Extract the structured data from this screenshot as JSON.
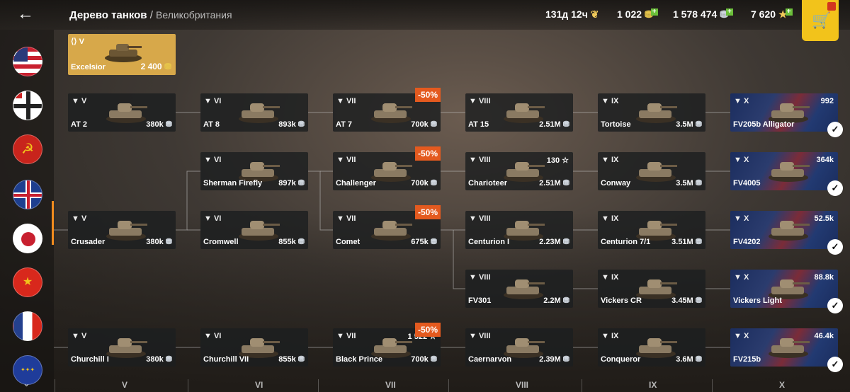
{
  "header": {
    "back_icon": "←",
    "title": "Дерево танков",
    "sep": "/",
    "subtitle": "Великобритания",
    "time": "131д 12ч",
    "gold_bonds": "1 022",
    "silver": "1 578 474",
    "free_xp": "7 620"
  },
  "premium": {
    "tier": "V",
    "name": "Excelsior",
    "price": "2 400"
  },
  "nations": [
    "usa",
    "germany",
    "ussr",
    "uk",
    "japan",
    "china",
    "france",
    "europe"
  ],
  "tiers": [
    "V",
    "VI",
    "VII",
    "VIII",
    "IX",
    "X"
  ],
  "tanks": [
    {
      "tier": "V",
      "name": "AT 2",
      "price": "380k"
    },
    {
      "tier": "VI",
      "name": "AT 8",
      "price": "893k"
    },
    {
      "tier": "VII",
      "name": "AT 7",
      "price": "700k",
      "discount": "-50%"
    },
    {
      "tier": "VIII",
      "name": "AT 15",
      "price": "2.51M"
    },
    {
      "tier": "IX",
      "name": "Tortoise",
      "price": "3.5M"
    },
    {
      "tier": "X",
      "name": "FV205b Alligator",
      "extra": "992"
    },
    {
      "tier": "VI",
      "name": "Sherman Firefly",
      "price": "897k"
    },
    {
      "tier": "VII",
      "name": "Challenger",
      "price": "700k",
      "discount": "-50%"
    },
    {
      "tier": "VIII",
      "name": "Charioteer",
      "price": "2.51M",
      "extra": "130 ☆"
    },
    {
      "tier": "IX",
      "name": "Conway",
      "price": "3.5M"
    },
    {
      "tier": "X",
      "name": "FV4005",
      "extra": "364k"
    },
    {
      "tier": "V",
      "name": "Crusader",
      "price": "380k"
    },
    {
      "tier": "VI",
      "name": "Cromwell",
      "price": "855k"
    },
    {
      "tier": "VII",
      "name": "Comet",
      "price": "675k",
      "discount": "-50%"
    },
    {
      "tier": "VIII",
      "name": "Centurion I",
      "price": "2.23M"
    },
    {
      "tier": "IX",
      "name": "Centurion 7/1",
      "price": "3.51M"
    },
    {
      "tier": "X",
      "name": "FV4202",
      "extra": "52.5k"
    },
    {
      "tier": "VIII",
      "name": "FV301",
      "price": "2.2M"
    },
    {
      "tier": "IX",
      "name": "Vickers CR",
      "price": "3.45M"
    },
    {
      "tier": "X",
      "name": "Vickers Light",
      "extra": "88.8k"
    },
    {
      "tier": "V",
      "name": "Churchill I",
      "price": "380k"
    },
    {
      "tier": "VI",
      "name": "Churchill VII",
      "price": "855k"
    },
    {
      "tier": "VII",
      "name": "Black Prince",
      "price": "700k",
      "discount": "-50%",
      "extra": "1 522 ☆"
    },
    {
      "tier": "VIII",
      "name": "Caernarvon",
      "price": "2.39M"
    },
    {
      "tier": "IX",
      "name": "Conqueror",
      "price": "3.6M"
    },
    {
      "tier": "X",
      "name": "FV215b",
      "extra": "46.4k"
    }
  ],
  "colors": {
    "accent": "#f28c1e",
    "discount": "#e45a1f",
    "shop": "#f2c31b"
  }
}
